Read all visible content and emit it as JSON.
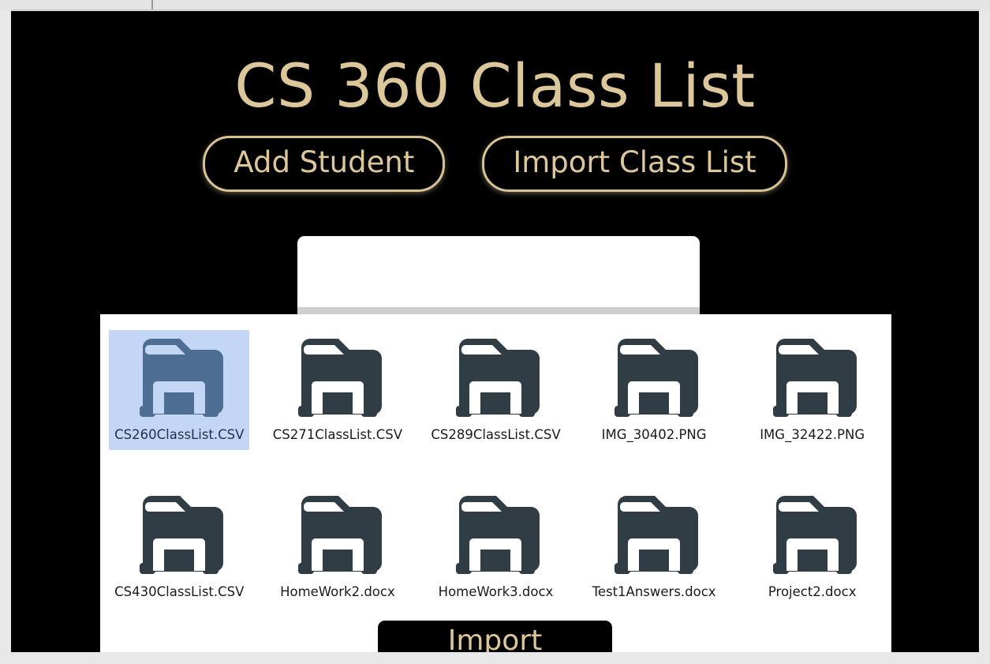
{
  "window": {
    "background_color": "#e8e8e8",
    "canvas_color": "#000000"
  },
  "header": {
    "title": "CS 360 Class List",
    "accent_color": "#dbc79a",
    "buttons": [
      {
        "label": "Add Student",
        "name": "add-student-button"
      },
      {
        "label": "Import Class List",
        "name": "import-class-list-button"
      }
    ]
  },
  "file_browser": {
    "panel_color": "#ffffff",
    "icon_color": "#303d45",
    "selected_icon_color": "#4e6d93",
    "selection_color": "#c3d6f5",
    "rows": [
      [
        {
          "label": "CS260ClassList.CSV",
          "icon": "file-folder-icon",
          "selected": true
        },
        {
          "label": "CS271ClassList.CSV",
          "icon": "file-folder-icon",
          "selected": false
        },
        {
          "label": "CS289ClassList.CSV",
          "icon": "file-folder-icon",
          "selected": false
        },
        {
          "label": "IMG_30402.PNG",
          "icon": "file-folder-icon",
          "selected": false
        },
        {
          "label": "IMG_32422.PNG",
          "icon": "file-folder-icon",
          "selected": false
        }
      ],
      [
        {
          "label": "CS430ClassList.CSV",
          "icon": "file-folder-icon",
          "selected": false
        },
        {
          "label": "HomeWork2.docx",
          "icon": "file-folder-icon",
          "selected": false
        },
        {
          "label": "HomeWork3.docx",
          "icon": "file-folder-icon",
          "selected": false
        },
        {
          "label": "Test1Answers.docx",
          "icon": "file-folder-icon",
          "selected": false
        },
        {
          "label": "Project2.docx",
          "icon": "file-folder-icon",
          "selected": false
        }
      ]
    ]
  },
  "footer": {
    "import_label": "Import"
  }
}
